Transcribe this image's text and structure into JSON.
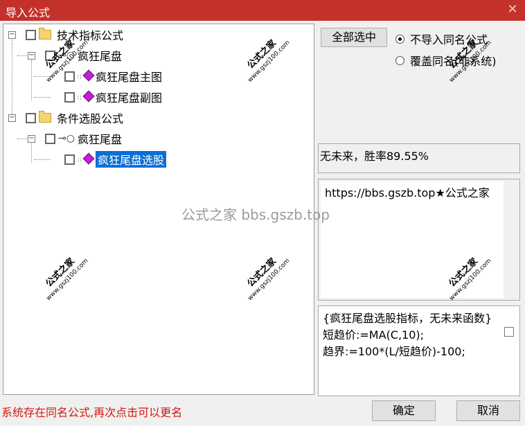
{
  "window": {
    "title": "导入公式",
    "close_glyph": "✕"
  },
  "tree": {
    "nodes": [
      {
        "label": "技术指标公式",
        "icon": "folder-icon"
      },
      {
        "label": "疯狂尾盘",
        "icon": "key-icon"
      },
      {
        "label": "疯狂尾盘主图",
        "icon": "formula-gem-icon"
      },
      {
        "label": "疯狂尾盘副图",
        "icon": "formula-gem-icon"
      },
      {
        "label": "条件选股公式",
        "icon": "folder-icon"
      },
      {
        "label": "疯狂尾盘",
        "icon": "key-icon"
      },
      {
        "label": "疯狂尾盘选股",
        "icon": "formula-gem-icon",
        "selected": true
      }
    ],
    "expander_glyph": "−"
  },
  "options": {
    "select_all_label": "全部选中",
    "radio_no_import": "不导入同名公式",
    "radio_overwrite": "覆盖同名(非系统)",
    "selected_radio": "radio_no_import"
  },
  "description": "无未来，胜率89.55%",
  "url_text": "https://bbs.gszb.top★公式之家",
  "code": {
    "line1": "{疯狂尾盘选股指标，无未来函数}",
    "line2": "短趋价:=MA(C,10);",
    "line3": "趋界:=100*(L/短趋价)-100;"
  },
  "status": "系统存在同名公式,再次点击可以更名",
  "buttons": {
    "ok": "确定",
    "cancel": "取消"
  },
  "watermark": {
    "center": "公式之家 bbs.gszb.top",
    "stamp_title": "公式之家",
    "stamp_url": "www.gszj100.com"
  },
  "colors": {
    "titlebar": "#c4312b",
    "selection": "#0a6fd6",
    "status": "#d4180e"
  }
}
